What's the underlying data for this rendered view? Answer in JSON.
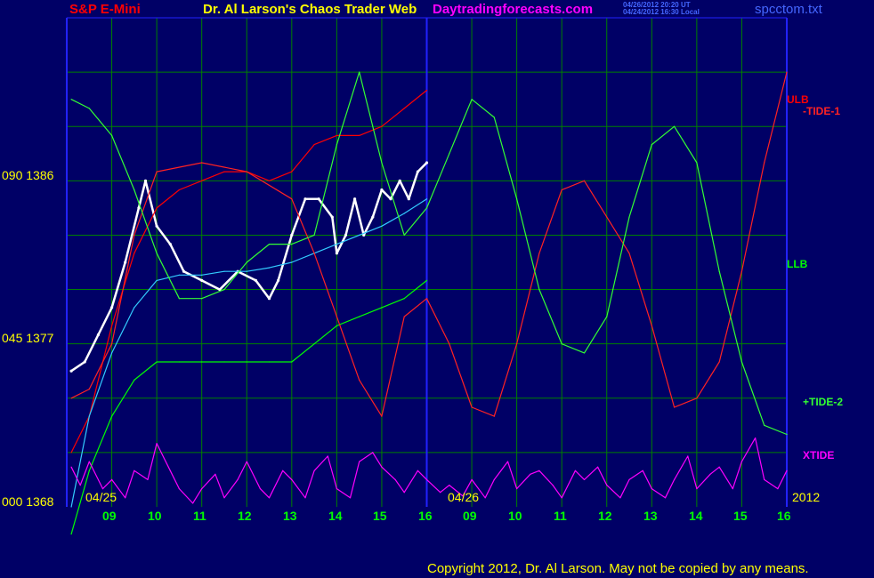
{
  "header": {
    "instrument": "S&P E-Mini",
    "title": "Dr. Al Larson's Chaos Trader Web",
    "site": "Daytradingforecasts.com",
    "timestamp_ut": "04/26/2012 20:20 UT",
    "timestamp_local": "04/24/2012 16:30 Local",
    "filename": "spcctom.txt"
  },
  "footer": {
    "copyright": "Copyright 2012, Dr. Al Larson. May not be copied by any means."
  },
  "colors": {
    "background": "#000066",
    "grid": "#008000",
    "axes": "#2222ff",
    "price": "#ffffff",
    "ulb": "#ff0000",
    "llb": "#00ff00",
    "tide1": "#ff2222",
    "tide2": "#33ff33",
    "xtide": "#ff00ff",
    "ma": "#33ccff",
    "text": "#ffff00",
    "title": "#ffff00",
    "instrument": "#ff0000",
    "site": "#ff00ff"
  },
  "chart_data": {
    "type": "line",
    "title": "S&P E-Mini",
    "y_ticks": [
      "000 1368",
      "045 1377",
      "090 1386"
    ],
    "ylim": [
      1368,
      1395
    ],
    "x_ticks": [
      "09",
      "10",
      "11",
      "12",
      "13",
      "14",
      "15",
      "16",
      "09",
      "10",
      "11",
      "12",
      "13",
      "14",
      "15",
      "16"
    ],
    "date_labels": [
      "04/25",
      "04/26",
      "2012"
    ],
    "grid": true,
    "legend": {
      "ulb": "ULB",
      "tide1": "-TIDE-1",
      "llb": "LLB",
      "tide2": "+TIDE-2",
      "xtide": "XTIDE"
    },
    "series": [
      {
        "name": "price",
        "x": [
          8.1,
          8.4,
          8.7,
          9.0,
          9.3,
          9.6,
          9.75,
          10.0,
          10.3,
          10.6,
          11.0,
          11.4,
          11.8,
          12.2,
          12.5,
          12.7,
          13.0,
          13.3,
          13.6,
          13.9,
          14.0,
          14.2,
          14.4,
          14.6,
          14.8,
          15.0,
          15.2,
          15.4,
          15.6,
          15.8,
          16.0
        ],
        "y": [
          1375.5,
          1376.0,
          1377.5,
          1379.0,
          1381.5,
          1384.5,
          1386.0,
          1383.5,
          1382.5,
          1381.0,
          1380.5,
          1380.0,
          1381.0,
          1380.5,
          1379.5,
          1380.5,
          1383.0,
          1385.0,
          1385.0,
          1384.0,
          1382.0,
          1383.0,
          1385.0,
          1383.0,
          1384.0,
          1385.5,
          1385.0,
          1386.0,
          1385.0,
          1386.5,
          1387.0
        ]
      },
      {
        "name": "ULB",
        "x": [
          8.1,
          8.5,
          9.0,
          9.5,
          10.0,
          10.5,
          11.0,
          11.5,
          12.0,
          12.5,
          13.0,
          13.5,
          14.0,
          14.5,
          15.0,
          15.5,
          16.0
        ],
        "y": [
          1371.0,
          1373.0,
          1378.0,
          1382.0,
          1384.5,
          1385.5,
          1386.0,
          1386.5,
          1386.5,
          1386.0,
          1386.5,
          1388.0,
          1388.5,
          1388.5,
          1389.0,
          1390.0,
          1391.0
        ]
      },
      {
        "name": "LLB",
        "x": [
          8.1,
          8.5,
          9.0,
          9.5,
          10.0,
          10.5,
          11.0,
          11.5,
          12.0,
          12.5,
          13.0,
          13.5,
          14.0,
          14.5,
          15.0,
          15.5,
          16.0
        ],
        "y": [
          1366.5,
          1370.0,
          1373.0,
          1375.0,
          1376.0,
          1376.0,
          1376.0,
          1376.0,
          1376.0,
          1376.0,
          1376.0,
          1377.0,
          1378.0,
          1378.5,
          1379.0,
          1379.5,
          1380.5
        ]
      },
      {
        "name": "MA",
        "x": [
          8.1,
          8.5,
          9.0,
          9.5,
          10.0,
          10.5,
          11.0,
          11.5,
          12.0,
          12.5,
          13.0,
          13.5,
          14.0,
          14.5,
          15.0,
          15.5,
          16.0
        ],
        "y": [
          1368.0,
          1373.0,
          1376.5,
          1379.0,
          1380.5,
          1380.8,
          1380.8,
          1381.0,
          1381.0,
          1381.2,
          1381.5,
          1382.0,
          1382.5,
          1383.0,
          1383.5,
          1384.2,
          1385.0
        ]
      },
      {
        "name": "-TIDE-1",
        "x": [
          8.1,
          8.5,
          9.0,
          9.5,
          10.0,
          11.0,
          12.0,
          13.0,
          13.5,
          14.0,
          14.5,
          15.0,
          15.5,
          16.0,
          16.5,
          17.0,
          17.5,
          18.0,
          18.5,
          19.0,
          19.5,
          20.0,
          20.5,
          21.0,
          21.5,
          22.0,
          22.5,
          23.0,
          23.5,
          24.0
        ],
        "y": [
          1374.0,
          1374.5,
          1377.0,
          1383.0,
          1386.5,
          1387.0,
          1386.5,
          1385.0,
          1382.0,
          1378.5,
          1375.0,
          1373.0,
          1378.5,
          1379.5,
          1377.0,
          1373.5,
          1373.0,
          1377.0,
          1382.0,
          1385.5,
          1386.0,
          1384.0,
          1382.0,
          1378.0,
          1373.5,
          1374.0,
          1376.0,
          1381.0,
          1387.0,
          1392.0
        ]
      },
      {
        "name": "+TIDE-2",
        "x": [
          8.1,
          8.5,
          9.0,
          9.5,
          10.0,
          10.5,
          11.0,
          11.5,
          12.0,
          12.5,
          13.0,
          13.5,
          14.0,
          14.5,
          15.0,
          15.5,
          16.0,
          16.5,
          17.0,
          17.5,
          18.0,
          18.5,
          19.0,
          19.5,
          20.0,
          20.5,
          21.0,
          21.5,
          22.0,
          22.5,
          23.0,
          23.5,
          24.0
        ],
        "y": [
          1390.5,
          1390.0,
          1388.5,
          1385.5,
          1382.0,
          1379.5,
          1379.5,
          1380.0,
          1381.5,
          1382.5,
          1382.5,
          1383.0,
          1388.0,
          1392.0,
          1387.0,
          1383.0,
          1384.5,
          1387.5,
          1390.5,
          1389.5,
          1385.0,
          1380.0,
          1377.0,
          1376.5,
          1378.5,
          1384.0,
          1388.0,
          1389.0,
          1387.0,
          1381.0,
          1376.0,
          1372.5,
          1372.0
        ]
      },
      {
        "name": "XTIDE",
        "x": [
          8.1,
          8.3,
          8.5,
          8.8,
          9.0,
          9.3,
          9.5,
          9.8,
          10.0,
          10.3,
          10.5,
          10.8,
          11.0,
          11.3,
          11.5,
          11.8,
          12.0,
          12.3,
          12.5,
          12.8,
          13.0,
          13.3,
          13.5,
          13.8,
          14.0,
          14.3,
          14.5,
          14.8,
          15.0,
          15.3,
          15.5,
          15.8,
          16.0,
          16.3,
          16.5,
          16.8,
          17.0,
          17.3,
          17.5,
          17.8,
          18.0,
          18.3,
          18.5,
          18.8,
          19.0,
          19.3,
          19.5,
          19.8,
          20.0,
          20.3,
          20.5,
          20.8,
          21.0,
          21.3,
          21.5,
          21.8,
          22.0,
          22.3,
          22.5,
          22.8,
          23.0,
          23.3,
          23.5,
          23.8,
          24.0
        ],
        "y": [
          1370.2,
          1369.2,
          1370.5,
          1369.0,
          1369.5,
          1368.5,
          1370.0,
          1369.5,
          1371.5,
          1370.0,
          1369.0,
          1368.2,
          1369.0,
          1369.8,
          1368.5,
          1369.5,
          1370.5,
          1369.0,
          1368.5,
          1370.0,
          1369.5,
          1368.5,
          1370.0,
          1370.8,
          1369.0,
          1368.5,
          1370.5,
          1371.0,
          1370.2,
          1369.5,
          1368.8,
          1370.0,
          1369.5,
          1368.8,
          1369.2,
          1368.6,
          1369.5,
          1368.5,
          1369.5,
          1370.5,
          1369.0,
          1369.8,
          1370.0,
          1369.2,
          1368.5,
          1370.0,
          1369.5,
          1370.2,
          1369.2,
          1368.5,
          1369.5,
          1370.0,
          1369.0,
          1368.5,
          1369.5,
          1370.8,
          1369.0,
          1369.8,
          1370.2,
          1369.0,
          1370.5,
          1371.8,
          1369.5,
          1369.0,
          1370.0
        ]
      }
    ]
  }
}
